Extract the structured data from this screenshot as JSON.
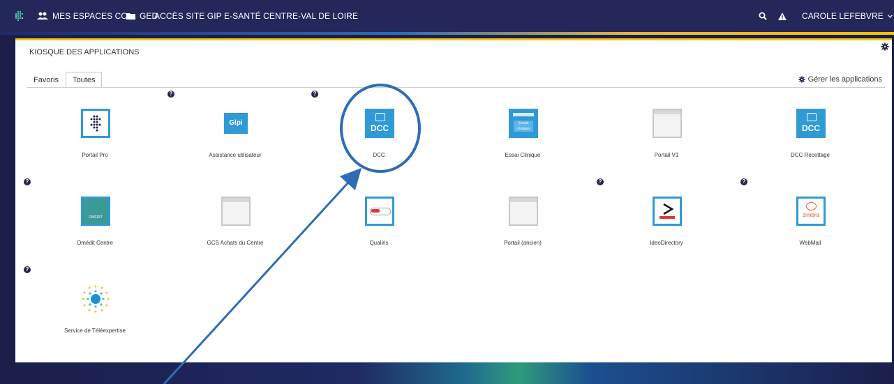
{
  "topbar": {
    "espaces": "MES ESPACES CO.",
    "ged": "GED",
    "acces": "ACCÈS SITE GIP E-SANTÉ CENTRE-VAL DE LOIRE",
    "user": "CAROLE LEFEBVRE"
  },
  "panel": {
    "title": "KIOSQUE DES APPLICATIONS",
    "tabs": [
      "Favoris",
      "Toutes"
    ],
    "active_tab": "Toutes",
    "manage": "Gérer les applications"
  },
  "apps": [
    {
      "label": "Portail Pro",
      "icon": "portail-pro-icon",
      "help": false
    },
    {
      "label": "Assistance utilisateur",
      "icon": "glpi-icon",
      "icon_text": "Glpi",
      "help": true
    },
    {
      "label": "DCC",
      "icon": "dcc-icon",
      "icon_text": "DCC",
      "help": true
    },
    {
      "label": "Essai Clinique",
      "icon": "essai-clinique-icon",
      "icon_text": "Essais cliniques",
      "help": false
    },
    {
      "label": "Portail V1",
      "icon": "blank-window-icon",
      "help": false
    },
    {
      "label": "DCC Recettage",
      "icon": "dcc-icon",
      "icon_text": "DCC",
      "help": false
    },
    {
      "label": "Omédit Centre",
      "icon": "omedit-icon",
      "icon_text": "OMEDIT",
      "help": true
    },
    {
      "label": "GCS Achats du Centre",
      "icon": "blank-window-icon",
      "help": false
    },
    {
      "label": "Qualiris",
      "icon": "qualiris-icon",
      "help": false
    },
    {
      "label": "Portail (ancien)",
      "icon": "blank-window-icon",
      "help": false
    },
    {
      "label": "IdeoDirectory",
      "icon": "ideo-icon",
      "help": true
    },
    {
      "label": "WebMail",
      "icon": "zimbra-icon",
      "icon_text": "zimbra",
      "help": true
    },
    {
      "label": "Service de Téléexpertise",
      "icon": "teleexpertise-icon",
      "help": true
    }
  ],
  "colors": {
    "topbar": "#24275a",
    "accent_yellow": "#f0c419",
    "icon_blue": "#2f9ad6",
    "annotation": "#2e6db5"
  }
}
